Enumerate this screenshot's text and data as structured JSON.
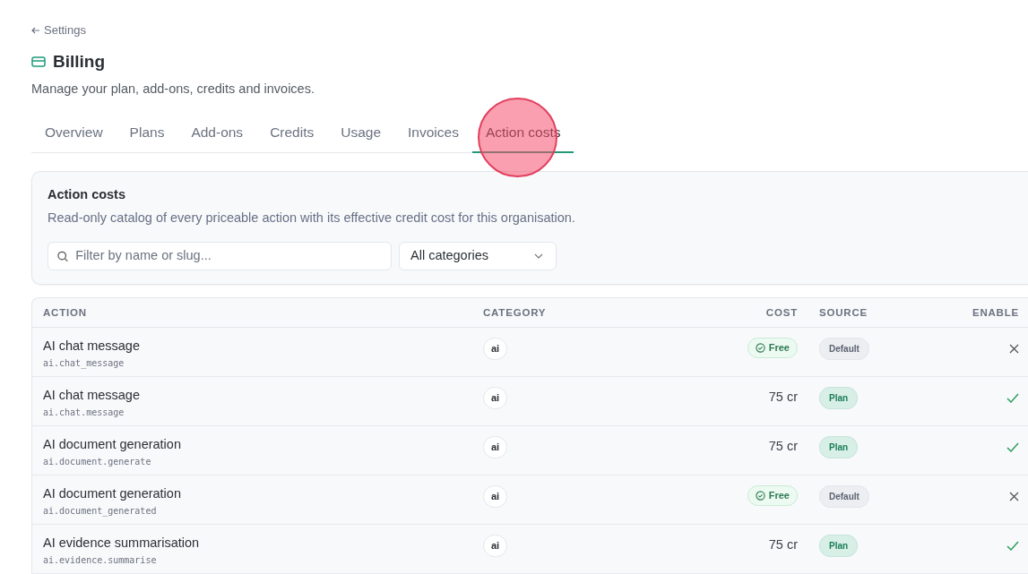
{
  "back_link": "Settings",
  "title": "Billing",
  "subtitle": "Manage your plan, add-ons, credits and invoices.",
  "tabs": [
    {
      "label": "Overview",
      "selected": false
    },
    {
      "label": "Plans",
      "selected": false
    },
    {
      "label": "Add-ons",
      "selected": false
    },
    {
      "label": "Credits",
      "selected": false
    },
    {
      "label": "Usage",
      "selected": false
    },
    {
      "label": "Invoices",
      "selected": false
    },
    {
      "label": "Action costs",
      "selected": true
    }
  ],
  "panel": {
    "title": "Action costs",
    "description": "Read-only catalog of every priceable action with its effective credit cost for this organisation.",
    "search": {
      "placeholder": "Filter by name or slug..."
    },
    "category_filter": "All categories"
  },
  "table": {
    "columns": [
      "ACTION",
      "CATEGORY",
      "COST",
      "SOURCE",
      "ENABLE"
    ],
    "rows": [
      {
        "name": "AI chat message",
        "slug": "ai.chat_message",
        "category": "ai",
        "cost": {
          "kind": "free",
          "text": "Free"
        },
        "source": {
          "kind": "default",
          "text": "Default"
        },
        "enabled": false
      },
      {
        "name": "AI chat message",
        "slug": "ai.chat.message",
        "category": "ai",
        "cost": {
          "kind": "credits",
          "text": "75 cr"
        },
        "source": {
          "kind": "plan",
          "text": "Plan"
        },
        "enabled": true
      },
      {
        "name": "AI document generation",
        "slug": "ai.document.generate",
        "category": "ai",
        "cost": {
          "kind": "credits",
          "text": "75 cr"
        },
        "source": {
          "kind": "plan",
          "text": "Plan"
        },
        "enabled": true
      },
      {
        "name": "AI document generation",
        "slug": "ai.document_generated",
        "category": "ai",
        "cost": {
          "kind": "free",
          "text": "Free"
        },
        "source": {
          "kind": "default",
          "text": "Default"
        },
        "enabled": false
      },
      {
        "name": "AI evidence summarisation",
        "slug": "ai.evidence.summarise",
        "category": "ai",
        "cost": {
          "kind": "credits",
          "text": "75 cr"
        },
        "source": {
          "kind": "plan",
          "text": "Plan"
        },
        "enabled": true
      }
    ]
  }
}
